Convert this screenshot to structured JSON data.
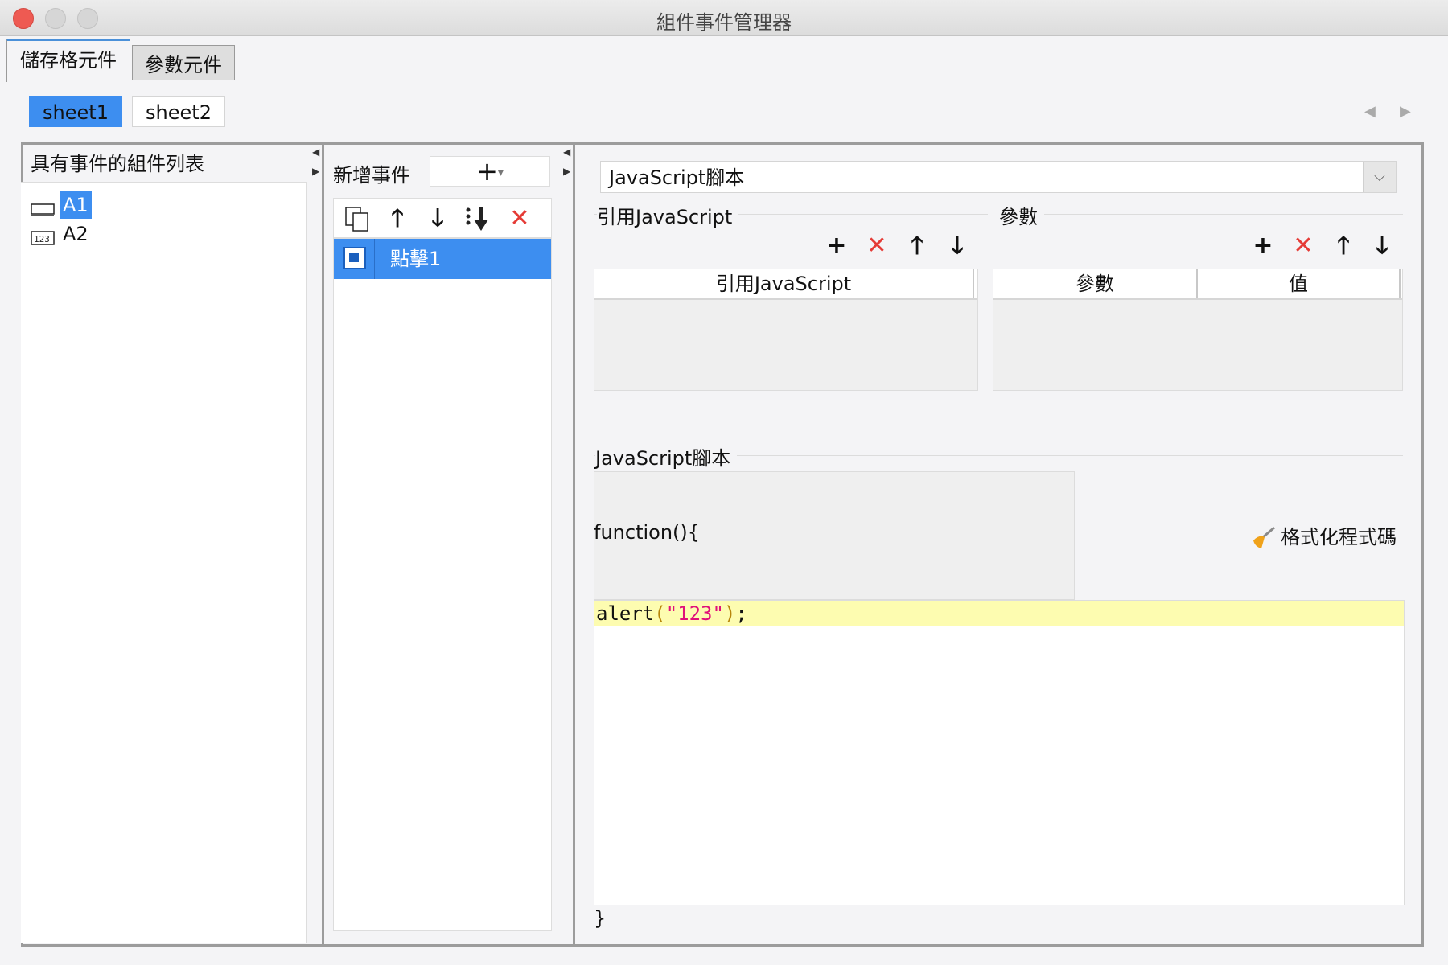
{
  "window": {
    "title": "組件事件管理器"
  },
  "tabs": [
    {
      "label": "儲存格元件",
      "active": true
    },
    {
      "label": "參數元件",
      "active": false
    }
  ],
  "sheets": [
    {
      "label": "sheet1",
      "active": true
    },
    {
      "label": "sheet2",
      "active": false
    }
  ],
  "component_list": {
    "header": "具有事件的組件列表",
    "items": [
      {
        "label": "A1",
        "selected": true,
        "icon": "text-field-icon"
      },
      {
        "label": "A2",
        "selected": false,
        "icon": "number-field-icon"
      }
    ]
  },
  "events": {
    "header": "新增事件",
    "add_label": "+",
    "toolbar": [
      "copy-icon",
      "move-up-icon",
      "move-down-icon",
      "move-bottom-icon",
      "delete-icon"
    ],
    "items": [
      {
        "label": "點擊1",
        "selected": true
      }
    ]
  },
  "script_panel": {
    "type_select": "JavaScript腳本",
    "ref_js": {
      "title": "引用JavaScript",
      "column": "引用JavaScript"
    },
    "params": {
      "title": "參數",
      "columns": [
        "參數",
        "值"
      ]
    },
    "script": {
      "title": "JavaScript腳本",
      "function_open": "function(){",
      "code_ident": "alert",
      "code_open": "(",
      "code_string": "\"123\"",
      "code_close": ")",
      "code_end": ";",
      "function_close": "}",
      "format_label": "格式化程式碼"
    }
  },
  "colors": {
    "accent": "#3d8ef0",
    "delete": "#e53b36",
    "highlight": "#fdfcb0",
    "string": "#e0107a"
  }
}
